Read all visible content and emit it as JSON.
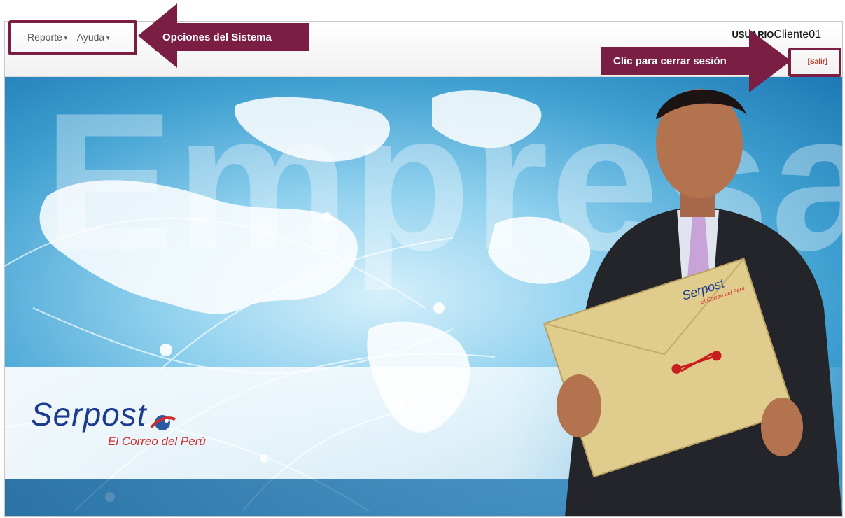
{
  "menu": {
    "items": [
      {
        "label": "Reporte"
      },
      {
        "label": "Ayuda"
      }
    ]
  },
  "user": {
    "label": "USUARIO",
    "name": "Cliente01"
  },
  "logout": {
    "label": "[Salir]"
  },
  "hero": {
    "watermark": "Empresas",
    "brand": "Serpost",
    "tagline": "El Correo del Perú",
    "envelope_brand": "Serpost",
    "envelope_tag": "El Correo del Perú"
  },
  "annotations": {
    "menu_callout": "Opciones del Sistema",
    "logout_callout": "Clic para cerrar sesión"
  },
  "colors": {
    "annotation": "#7a1e44",
    "brand_blue": "#1c3c91",
    "brand_red": "#d32a2a",
    "logout_red": "#c0392b"
  }
}
